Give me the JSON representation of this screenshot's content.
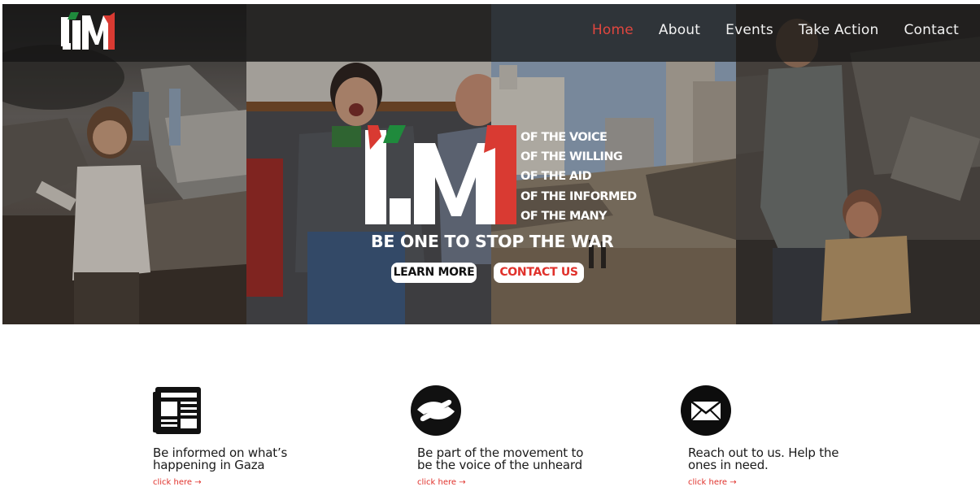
{
  "nav": {
    "items": [
      {
        "label": "Home",
        "active": true
      },
      {
        "label": "About",
        "active": false
      },
      {
        "label": "Events",
        "active": false
      },
      {
        "label": "Take Action",
        "active": false
      },
      {
        "label": "Contact",
        "active": false
      }
    ]
  },
  "hero": {
    "taglines": [
      "OF THE VOICE",
      "OF THE WILLING",
      "OF THE AID",
      "OF THE INFORMED",
      "OF THE MANY"
    ],
    "headline": "BE ONE TO STOP THE WAR",
    "learn_more_label": "LEARN MORE",
    "contact_label": "CONTACT US"
  },
  "features": [
    {
      "icon": "newspaper-icon",
      "text_line1": "Be informed on what’s",
      "text_line2": "happening in Gaza",
      "link": "click here →"
    },
    {
      "icon": "helping-hands-icon",
      "text_line1": "Be part of the movement to",
      "text_line2": "be the voice of the unheard",
      "link": "click here →"
    },
    {
      "icon": "envelope-icon",
      "text_line1": "Reach out to us. Help the",
      "text_line2": "ones in need.",
      "link": "click here →"
    }
  ],
  "colors": {
    "accent": "#e0312b",
    "nav_active": "#e0463f",
    "nav_bg": "#141414",
    "text": "#1a1a1a",
    "logo_green": "#1f8a3c"
  }
}
